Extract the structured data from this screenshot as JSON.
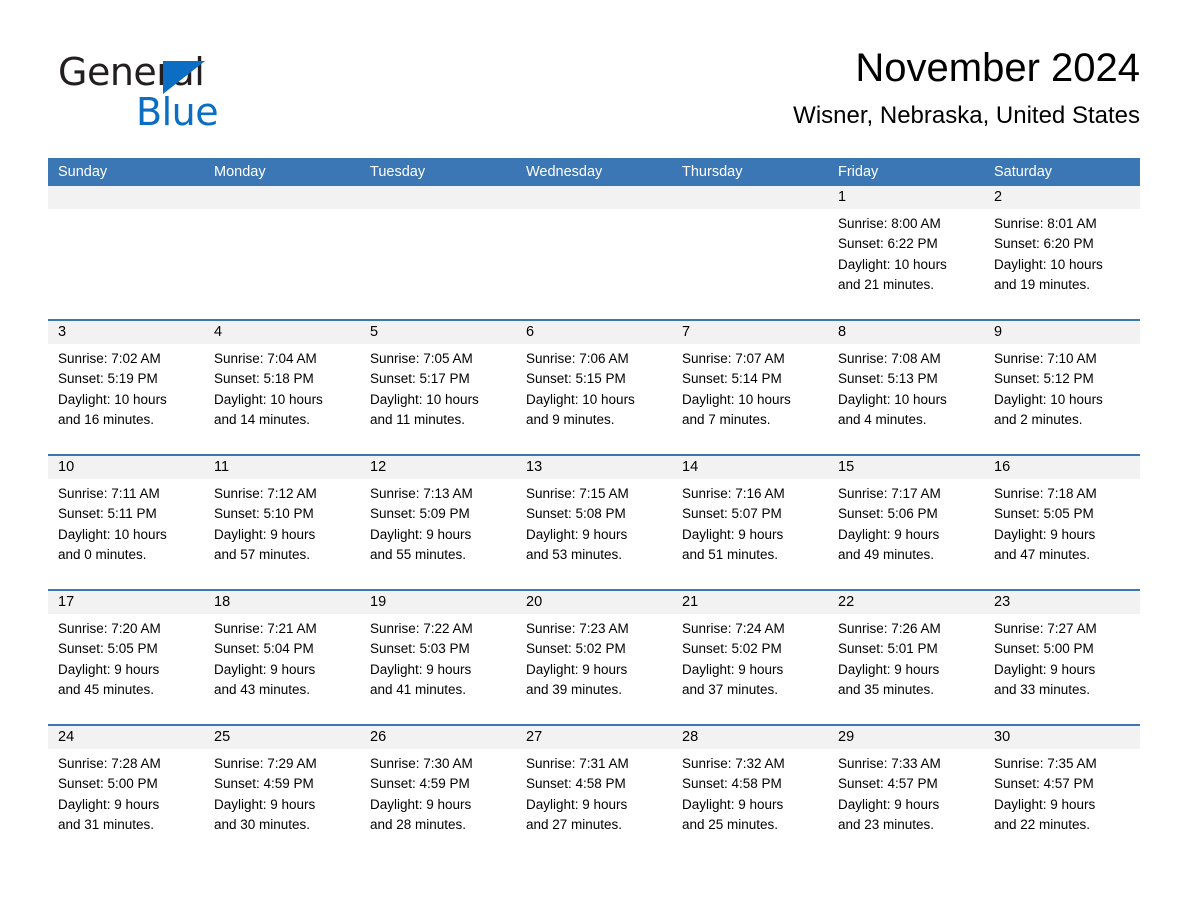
{
  "brand": {
    "name_part1": "General",
    "name_part2": "Blue",
    "triangle_color": "#0b6ec3"
  },
  "header": {
    "title": "November 2024",
    "subtitle": "Wisner, Nebraska, United States"
  },
  "theme": {
    "header_bar_color": "#3b77b5",
    "daynum_band_color": "#f2f2f2",
    "row_divider_color": "#3b77b5"
  },
  "weekdays": [
    "Sunday",
    "Monday",
    "Tuesday",
    "Wednesday",
    "Thursday",
    "Friday",
    "Saturday"
  ],
  "weeks": [
    [
      {
        "day": "",
        "sunrise": "",
        "sunset": "",
        "daylight1": "",
        "daylight2": ""
      },
      {
        "day": "",
        "sunrise": "",
        "sunset": "",
        "daylight1": "",
        "daylight2": ""
      },
      {
        "day": "",
        "sunrise": "",
        "sunset": "",
        "daylight1": "",
        "daylight2": ""
      },
      {
        "day": "",
        "sunrise": "",
        "sunset": "",
        "daylight1": "",
        "daylight2": ""
      },
      {
        "day": "",
        "sunrise": "",
        "sunset": "",
        "daylight1": "",
        "daylight2": ""
      },
      {
        "day": "1",
        "sunrise": "Sunrise: 8:00 AM",
        "sunset": "Sunset: 6:22 PM",
        "daylight1": "Daylight: 10 hours",
        "daylight2": "and 21 minutes."
      },
      {
        "day": "2",
        "sunrise": "Sunrise: 8:01 AM",
        "sunset": "Sunset: 6:20 PM",
        "daylight1": "Daylight: 10 hours",
        "daylight2": "and 19 minutes."
      }
    ],
    [
      {
        "day": "3",
        "sunrise": "Sunrise: 7:02 AM",
        "sunset": "Sunset: 5:19 PM",
        "daylight1": "Daylight: 10 hours",
        "daylight2": "and 16 minutes."
      },
      {
        "day": "4",
        "sunrise": "Sunrise: 7:04 AM",
        "sunset": "Sunset: 5:18 PM",
        "daylight1": "Daylight: 10 hours",
        "daylight2": "and 14 minutes."
      },
      {
        "day": "5",
        "sunrise": "Sunrise: 7:05 AM",
        "sunset": "Sunset: 5:17 PM",
        "daylight1": "Daylight: 10 hours",
        "daylight2": "and 11 minutes."
      },
      {
        "day": "6",
        "sunrise": "Sunrise: 7:06 AM",
        "sunset": "Sunset: 5:15 PM",
        "daylight1": "Daylight: 10 hours",
        "daylight2": "and 9 minutes."
      },
      {
        "day": "7",
        "sunrise": "Sunrise: 7:07 AM",
        "sunset": "Sunset: 5:14 PM",
        "daylight1": "Daylight: 10 hours",
        "daylight2": "and 7 minutes."
      },
      {
        "day": "8",
        "sunrise": "Sunrise: 7:08 AM",
        "sunset": "Sunset: 5:13 PM",
        "daylight1": "Daylight: 10 hours",
        "daylight2": "and 4 minutes."
      },
      {
        "day": "9",
        "sunrise": "Sunrise: 7:10 AM",
        "sunset": "Sunset: 5:12 PM",
        "daylight1": "Daylight: 10 hours",
        "daylight2": "and 2 minutes."
      }
    ],
    [
      {
        "day": "10",
        "sunrise": "Sunrise: 7:11 AM",
        "sunset": "Sunset: 5:11 PM",
        "daylight1": "Daylight: 10 hours",
        "daylight2": "and 0 minutes."
      },
      {
        "day": "11",
        "sunrise": "Sunrise: 7:12 AM",
        "sunset": "Sunset: 5:10 PM",
        "daylight1": "Daylight: 9 hours",
        "daylight2": "and 57 minutes."
      },
      {
        "day": "12",
        "sunrise": "Sunrise: 7:13 AM",
        "sunset": "Sunset: 5:09 PM",
        "daylight1": "Daylight: 9 hours",
        "daylight2": "and 55 minutes."
      },
      {
        "day": "13",
        "sunrise": "Sunrise: 7:15 AM",
        "sunset": "Sunset: 5:08 PM",
        "daylight1": "Daylight: 9 hours",
        "daylight2": "and 53 minutes."
      },
      {
        "day": "14",
        "sunrise": "Sunrise: 7:16 AM",
        "sunset": "Sunset: 5:07 PM",
        "daylight1": "Daylight: 9 hours",
        "daylight2": "and 51 minutes."
      },
      {
        "day": "15",
        "sunrise": "Sunrise: 7:17 AM",
        "sunset": "Sunset: 5:06 PM",
        "daylight1": "Daylight: 9 hours",
        "daylight2": "and 49 minutes."
      },
      {
        "day": "16",
        "sunrise": "Sunrise: 7:18 AM",
        "sunset": "Sunset: 5:05 PM",
        "daylight1": "Daylight: 9 hours",
        "daylight2": "and 47 minutes."
      }
    ],
    [
      {
        "day": "17",
        "sunrise": "Sunrise: 7:20 AM",
        "sunset": "Sunset: 5:05 PM",
        "daylight1": "Daylight: 9 hours",
        "daylight2": "and 45 minutes."
      },
      {
        "day": "18",
        "sunrise": "Sunrise: 7:21 AM",
        "sunset": "Sunset: 5:04 PM",
        "daylight1": "Daylight: 9 hours",
        "daylight2": "and 43 minutes."
      },
      {
        "day": "19",
        "sunrise": "Sunrise: 7:22 AM",
        "sunset": "Sunset: 5:03 PM",
        "daylight1": "Daylight: 9 hours",
        "daylight2": "and 41 minutes."
      },
      {
        "day": "20",
        "sunrise": "Sunrise: 7:23 AM",
        "sunset": "Sunset: 5:02 PM",
        "daylight1": "Daylight: 9 hours",
        "daylight2": "and 39 minutes."
      },
      {
        "day": "21",
        "sunrise": "Sunrise: 7:24 AM",
        "sunset": "Sunset: 5:02 PM",
        "daylight1": "Daylight: 9 hours",
        "daylight2": "and 37 minutes."
      },
      {
        "day": "22",
        "sunrise": "Sunrise: 7:26 AM",
        "sunset": "Sunset: 5:01 PM",
        "daylight1": "Daylight: 9 hours",
        "daylight2": "and 35 minutes."
      },
      {
        "day": "23",
        "sunrise": "Sunrise: 7:27 AM",
        "sunset": "Sunset: 5:00 PM",
        "daylight1": "Daylight: 9 hours",
        "daylight2": "and 33 minutes."
      }
    ],
    [
      {
        "day": "24",
        "sunrise": "Sunrise: 7:28 AM",
        "sunset": "Sunset: 5:00 PM",
        "daylight1": "Daylight: 9 hours",
        "daylight2": "and 31 minutes."
      },
      {
        "day": "25",
        "sunrise": "Sunrise: 7:29 AM",
        "sunset": "Sunset: 4:59 PM",
        "daylight1": "Daylight: 9 hours",
        "daylight2": "and 30 minutes."
      },
      {
        "day": "26",
        "sunrise": "Sunrise: 7:30 AM",
        "sunset": "Sunset: 4:59 PM",
        "daylight1": "Daylight: 9 hours",
        "daylight2": "and 28 minutes."
      },
      {
        "day": "27",
        "sunrise": "Sunrise: 7:31 AM",
        "sunset": "Sunset: 4:58 PM",
        "daylight1": "Daylight: 9 hours",
        "daylight2": "and 27 minutes."
      },
      {
        "day": "28",
        "sunrise": "Sunrise: 7:32 AM",
        "sunset": "Sunset: 4:58 PM",
        "daylight1": "Daylight: 9 hours",
        "daylight2": "and 25 minutes."
      },
      {
        "day": "29",
        "sunrise": "Sunrise: 7:33 AM",
        "sunset": "Sunset: 4:57 PM",
        "daylight1": "Daylight: 9 hours",
        "daylight2": "and 23 minutes."
      },
      {
        "day": "30",
        "sunrise": "Sunrise: 7:35 AM",
        "sunset": "Sunset: 4:57 PM",
        "daylight1": "Daylight: 9 hours",
        "daylight2": "and 22 minutes."
      }
    ]
  ]
}
